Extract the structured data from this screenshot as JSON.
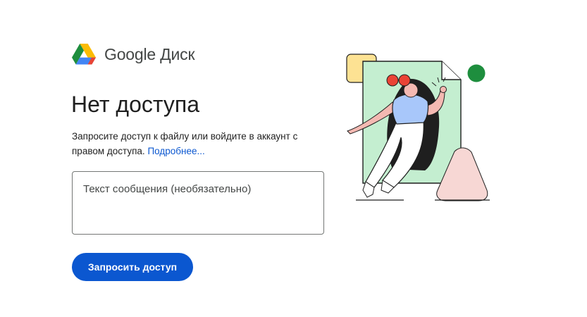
{
  "header": {
    "brand": "Google Диск",
    "logo_icon": "google-drive-logo-icon"
  },
  "main": {
    "title": "Нет доступа",
    "description": "Запросите доступ к файлу или войдите в аккаунт с правом доступа.",
    "learn_more": "Подробнее...",
    "message_placeholder": "Текст сообщения (необязательно)",
    "request_button": "Запросить доступ"
  },
  "illustration": {
    "icon": "person-leaving-document-illustration"
  },
  "colors": {
    "accent": "#0b57d0",
    "drive_green": "#1e8e3e",
    "drive_blue": "#4285f4",
    "drive_yellow": "#fbbc04",
    "drive_red": "#ea4335"
  }
}
